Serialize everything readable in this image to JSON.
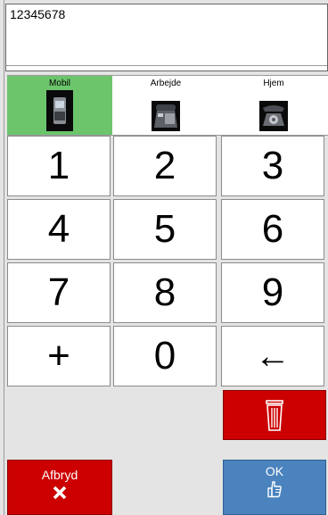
{
  "display": {
    "value": "12345678"
  },
  "phone_types": [
    {
      "label": "Mobil",
      "icon": "mobile-phone-icon",
      "selected": true
    },
    {
      "label": "Arbejde",
      "icon": "office-phone-icon",
      "selected": false
    },
    {
      "label": "Hjem",
      "icon": "home-phone-icon",
      "selected": false
    }
  ],
  "keypad": {
    "keys": [
      "1",
      "2",
      "3",
      "4",
      "5",
      "6",
      "7",
      "8",
      "9",
      "+",
      "0",
      "←"
    ]
  },
  "actions": {
    "delete_icon": "trash-icon",
    "cancel_label": "Afbryd",
    "cancel_icon": "x-icon",
    "ok_label": "OK",
    "ok_icon": "thumbs-up-icon"
  },
  "colors": {
    "selected_type": "#6cc56b",
    "danger": "#cc0000",
    "ok": "#4a83bd"
  }
}
